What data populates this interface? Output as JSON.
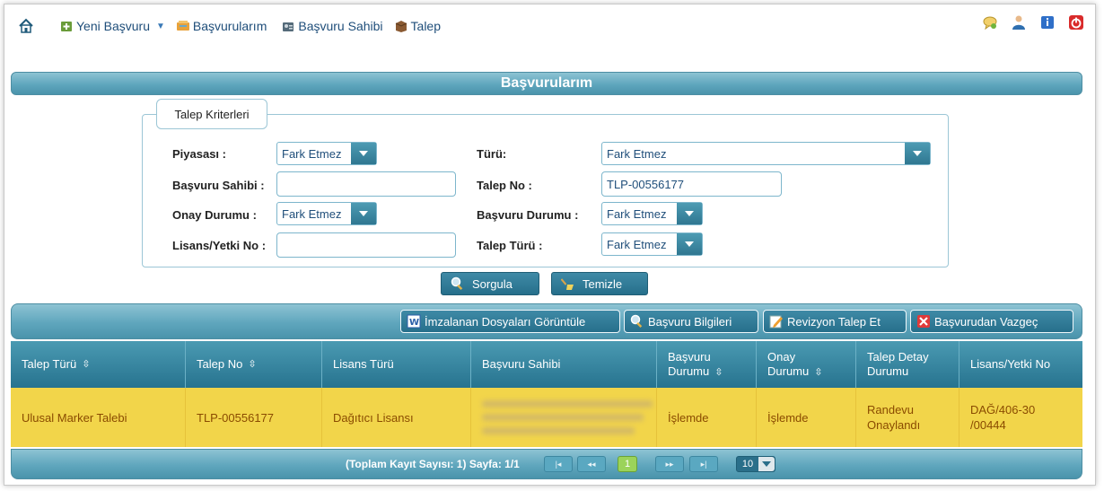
{
  "menu": {
    "yeni_basvuru": "Yeni Başvuru",
    "basvurularim": "Başvurularım",
    "basvuru_sahibi": "Başvuru Sahibi",
    "talep": "Talep"
  },
  "title": "Başvurularım",
  "criteria": {
    "legend": "Talep Kriterleri",
    "piyasasi_label": "Piyasası :",
    "piyasasi_value": "Fark Etmez",
    "turu_label": "Türü:",
    "turu_value": "Fark Etmez",
    "basvuru_sahibi_label": "Başvuru Sahibi :",
    "basvuru_sahibi_value": "",
    "talep_no_label": "Talep No :",
    "talep_no_value": "TLP-00556177",
    "onay_durumu_label": "Onay Durumu :",
    "onay_durumu_value": "Fark Etmez",
    "basvuru_durumu_label": "Başvuru Durumu :",
    "basvuru_durumu_value": "Fark Etmez",
    "lisans_no_label": "Lisans/Yetki No :",
    "lisans_no_value": "",
    "talep_turu_label": "Talep Türü :",
    "talep_turu_value": "Fark Etmez"
  },
  "buttons": {
    "sorgula": "Sorgula",
    "temizle": "Temizle"
  },
  "toolbar": {
    "imzalanan": "İmzalanan Dosyaları Görüntüle",
    "basvuru_bilgileri": "Başvuru Bilgileri",
    "revizyon": "Revizyon Talep Et",
    "vazgec": "Başvurudan Vazgeç"
  },
  "table": {
    "headers": {
      "talep_turu": "Talep Türü",
      "talep_no": "Talep No",
      "lisans_turu": "Lisans Türü",
      "basvuru_sahibi": "Başvuru Sahibi",
      "basvuru_durumu_1": "Başvuru",
      "basvuru_durumu_2": "Durumu",
      "onay_durumu_1": "Onay",
      "onay_durumu_2": "Durumu",
      "talep_detay_1": "Talep Detay",
      "talep_detay_2": "Durumu",
      "lisans_yetki_no": "Lisans/Yetki No"
    },
    "row": {
      "talep_turu": "Ulusal Marker Talebi",
      "talep_no": "TLP-00556177",
      "lisans_turu": "Dağıtıcı Lisansı",
      "basvuru_durumu": "İşlemde",
      "onay_durumu": "İşlemde",
      "talep_detay_1": "Randevu",
      "talep_detay_2": "Onaylandı",
      "lisans_no_1": "DAĞ/406-30",
      "lisans_no_2": "/00444"
    }
  },
  "pager": {
    "info": "(Toplam Kayıt Sayısı: 1) Sayfa: 1/1",
    "current_page": "1",
    "page_size": "10"
  }
}
